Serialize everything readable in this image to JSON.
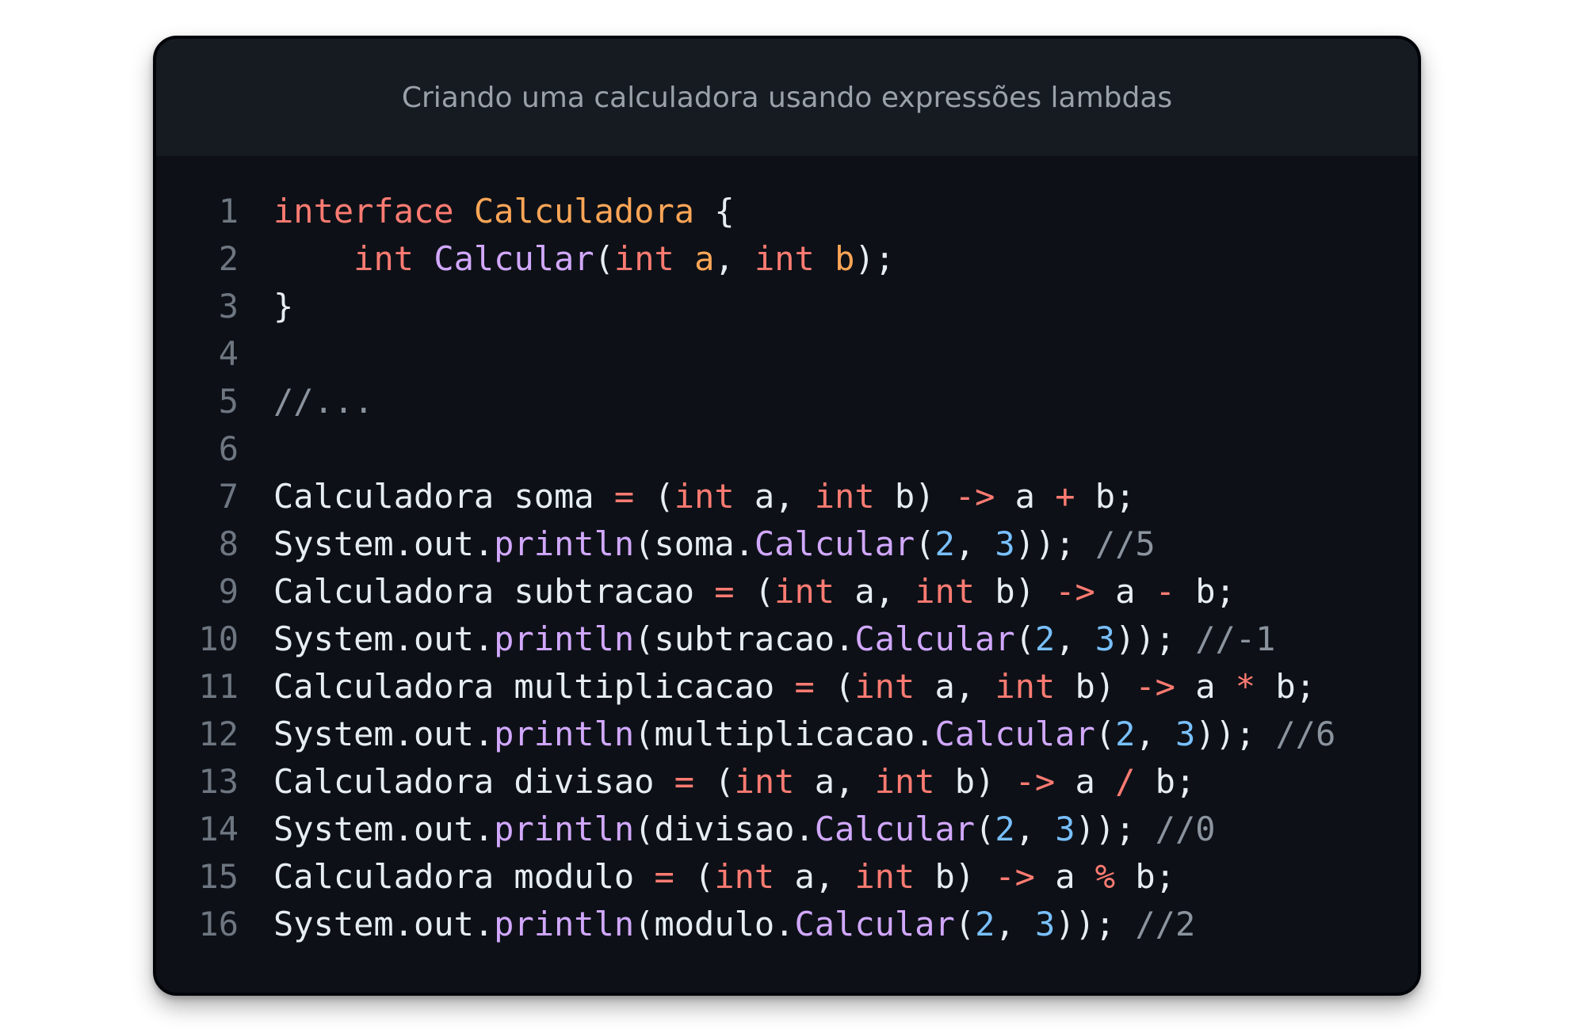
{
  "window": {
    "title": "Criando uma calculadora usando expressões lambdas"
  },
  "colors": {
    "background": "#0d1117",
    "titlebar": "#161b22",
    "plain": "#e6edf3",
    "keyword": "#ff7b72",
    "type_name": "#ffa657",
    "method": "#d2a8ff",
    "param": "#ffa657",
    "number": "#79c0ff",
    "comment": "#8b949e",
    "line_number": "#6e7681"
  },
  "editor": {
    "language": "java",
    "lines": [
      {
        "n": "1",
        "tokens": [
          {
            "t": "interface",
            "c": "keyword"
          },
          {
            "t": " ",
            "c": "plain"
          },
          {
            "t": "Calculadora",
            "c": "type_name"
          },
          {
            "t": " {",
            "c": "plain"
          }
        ]
      },
      {
        "n": "2",
        "tokens": [
          {
            "t": "    ",
            "c": "plain"
          },
          {
            "t": "int",
            "c": "keyword"
          },
          {
            "t": " ",
            "c": "plain"
          },
          {
            "t": "Calcular",
            "c": "method"
          },
          {
            "t": "(",
            "c": "plain"
          },
          {
            "t": "int",
            "c": "keyword"
          },
          {
            "t": " ",
            "c": "plain"
          },
          {
            "t": "a",
            "c": "param"
          },
          {
            "t": ", ",
            "c": "plain"
          },
          {
            "t": "int",
            "c": "keyword"
          },
          {
            "t": " ",
            "c": "plain"
          },
          {
            "t": "b",
            "c": "param"
          },
          {
            "t": ");",
            "c": "plain"
          }
        ]
      },
      {
        "n": "3",
        "tokens": [
          {
            "t": "}",
            "c": "plain"
          }
        ]
      },
      {
        "n": "4",
        "tokens": []
      },
      {
        "n": "5",
        "tokens": [
          {
            "t": "//...",
            "c": "comment"
          }
        ]
      },
      {
        "n": "6",
        "tokens": []
      },
      {
        "n": "7",
        "tokens": [
          {
            "t": "Calculadora soma ",
            "c": "plain"
          },
          {
            "t": "=",
            "c": "keyword"
          },
          {
            "t": " (",
            "c": "plain"
          },
          {
            "t": "int",
            "c": "keyword"
          },
          {
            "t": " a, ",
            "c": "plain"
          },
          {
            "t": "int",
            "c": "keyword"
          },
          {
            "t": " b) ",
            "c": "plain"
          },
          {
            "t": "->",
            "c": "keyword"
          },
          {
            "t": " a ",
            "c": "plain"
          },
          {
            "t": "+",
            "c": "keyword"
          },
          {
            "t": " b;",
            "c": "plain"
          }
        ]
      },
      {
        "n": "8",
        "tokens": [
          {
            "t": "System.out.",
            "c": "plain"
          },
          {
            "t": "println",
            "c": "method"
          },
          {
            "t": "(soma.",
            "c": "plain"
          },
          {
            "t": "Calcular",
            "c": "method"
          },
          {
            "t": "(",
            "c": "plain"
          },
          {
            "t": "2",
            "c": "number"
          },
          {
            "t": ", ",
            "c": "plain"
          },
          {
            "t": "3",
            "c": "number"
          },
          {
            "t": ")); ",
            "c": "plain"
          },
          {
            "t": "//5",
            "c": "comment"
          }
        ]
      },
      {
        "n": "9",
        "tokens": [
          {
            "t": "Calculadora subtracao ",
            "c": "plain"
          },
          {
            "t": "=",
            "c": "keyword"
          },
          {
            "t": " (",
            "c": "plain"
          },
          {
            "t": "int",
            "c": "keyword"
          },
          {
            "t": " a, ",
            "c": "plain"
          },
          {
            "t": "int",
            "c": "keyword"
          },
          {
            "t": " b) ",
            "c": "plain"
          },
          {
            "t": "->",
            "c": "keyword"
          },
          {
            "t": " a ",
            "c": "plain"
          },
          {
            "t": "-",
            "c": "keyword"
          },
          {
            "t": " b;",
            "c": "plain"
          }
        ]
      },
      {
        "n": "10",
        "tokens": [
          {
            "t": "System.out.",
            "c": "plain"
          },
          {
            "t": "println",
            "c": "method"
          },
          {
            "t": "(subtracao.",
            "c": "plain"
          },
          {
            "t": "Calcular",
            "c": "method"
          },
          {
            "t": "(",
            "c": "plain"
          },
          {
            "t": "2",
            "c": "number"
          },
          {
            "t": ", ",
            "c": "plain"
          },
          {
            "t": "3",
            "c": "number"
          },
          {
            "t": ")); ",
            "c": "plain"
          },
          {
            "t": "//-1",
            "c": "comment"
          }
        ]
      },
      {
        "n": "11",
        "tokens": [
          {
            "t": "Calculadora multiplicacao ",
            "c": "plain"
          },
          {
            "t": "=",
            "c": "keyword"
          },
          {
            "t": " (",
            "c": "plain"
          },
          {
            "t": "int",
            "c": "keyword"
          },
          {
            "t": " a, ",
            "c": "plain"
          },
          {
            "t": "int",
            "c": "keyword"
          },
          {
            "t": " b) ",
            "c": "plain"
          },
          {
            "t": "->",
            "c": "keyword"
          },
          {
            "t": " a ",
            "c": "plain"
          },
          {
            "t": "*",
            "c": "keyword"
          },
          {
            "t": " b;",
            "c": "plain"
          }
        ]
      },
      {
        "n": "12",
        "tokens": [
          {
            "t": "System.out.",
            "c": "plain"
          },
          {
            "t": "println",
            "c": "method"
          },
          {
            "t": "(multiplicacao.",
            "c": "plain"
          },
          {
            "t": "Calcular",
            "c": "method"
          },
          {
            "t": "(",
            "c": "plain"
          },
          {
            "t": "2",
            "c": "number"
          },
          {
            "t": ", ",
            "c": "plain"
          },
          {
            "t": "3",
            "c": "number"
          },
          {
            "t": ")); ",
            "c": "plain"
          },
          {
            "t": "//6",
            "c": "comment"
          }
        ]
      },
      {
        "n": "13",
        "tokens": [
          {
            "t": "Calculadora divisao ",
            "c": "plain"
          },
          {
            "t": "=",
            "c": "keyword"
          },
          {
            "t": " (",
            "c": "plain"
          },
          {
            "t": "int",
            "c": "keyword"
          },
          {
            "t": " a, ",
            "c": "plain"
          },
          {
            "t": "int",
            "c": "keyword"
          },
          {
            "t": " b) ",
            "c": "plain"
          },
          {
            "t": "->",
            "c": "keyword"
          },
          {
            "t": " a ",
            "c": "plain"
          },
          {
            "t": "/",
            "c": "keyword"
          },
          {
            "t": " b;",
            "c": "plain"
          }
        ]
      },
      {
        "n": "14",
        "tokens": [
          {
            "t": "System.out.",
            "c": "plain"
          },
          {
            "t": "println",
            "c": "method"
          },
          {
            "t": "(divisao.",
            "c": "plain"
          },
          {
            "t": "Calcular",
            "c": "method"
          },
          {
            "t": "(",
            "c": "plain"
          },
          {
            "t": "2",
            "c": "number"
          },
          {
            "t": ", ",
            "c": "plain"
          },
          {
            "t": "3",
            "c": "number"
          },
          {
            "t": ")); ",
            "c": "plain"
          },
          {
            "t": "//0",
            "c": "comment"
          }
        ]
      },
      {
        "n": "15",
        "tokens": [
          {
            "t": "Calculadora modulo ",
            "c": "plain"
          },
          {
            "t": "=",
            "c": "keyword"
          },
          {
            "t": " (",
            "c": "plain"
          },
          {
            "t": "int",
            "c": "keyword"
          },
          {
            "t": " a, ",
            "c": "plain"
          },
          {
            "t": "int",
            "c": "keyword"
          },
          {
            "t": " b) ",
            "c": "plain"
          },
          {
            "t": "->",
            "c": "keyword"
          },
          {
            "t": " a ",
            "c": "plain"
          },
          {
            "t": "%",
            "c": "keyword"
          },
          {
            "t": " b;",
            "c": "plain"
          }
        ]
      },
      {
        "n": "16",
        "tokens": [
          {
            "t": "System.out.",
            "c": "plain"
          },
          {
            "t": "println",
            "c": "method"
          },
          {
            "t": "(modulo.",
            "c": "plain"
          },
          {
            "t": "Calcular",
            "c": "method"
          },
          {
            "t": "(",
            "c": "plain"
          },
          {
            "t": "2",
            "c": "number"
          },
          {
            "t": ", ",
            "c": "plain"
          },
          {
            "t": "3",
            "c": "number"
          },
          {
            "t": ")); ",
            "c": "plain"
          },
          {
            "t": "//2",
            "c": "comment"
          }
        ]
      }
    ]
  }
}
